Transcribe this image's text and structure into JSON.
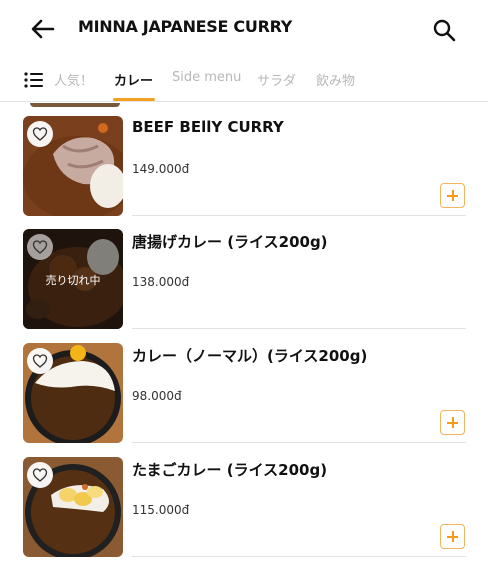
{
  "header": {
    "title": "MINNA JAPANESE CURRY",
    "back_icon": "arrow-left-icon",
    "search_icon": "search-icon"
  },
  "tabs": [
    {
      "label": "人気！",
      "active": false
    },
    {
      "label": "カレー",
      "active": true
    },
    {
      "label": "Side menu",
      "active": false
    },
    {
      "label": "サラダ",
      "active": false
    },
    {
      "label": "飲み物",
      "active": false
    }
  ],
  "colors": {
    "accent": "#f4a021",
    "inactive_tab": "#b8b8b8"
  },
  "items": [
    {
      "name": "BEEF BEllY CURRY",
      "price": "149.000đ",
      "sold_out": false,
      "has_add_button": true
    },
    {
      "name": "唐揚げカレー (ライス200g)",
      "price": "138.000đ",
      "sold_out": true,
      "sold_out_label": "売り切れ中",
      "has_add_button": false
    },
    {
      "name": "カレー（ノーマル）(ライス200g)",
      "price": "98.000đ",
      "sold_out": false,
      "has_add_button": true
    },
    {
      "name": "たまごカレー (ライス200g)",
      "price": "115.000đ",
      "sold_out": false,
      "has_add_button": true
    }
  ]
}
